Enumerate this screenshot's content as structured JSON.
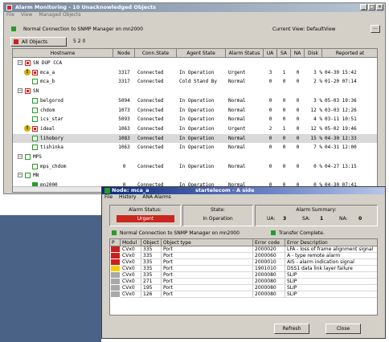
{
  "main_window": {
    "title": "Alarm Monitoring - 10 Unacknowledged Objects",
    "menu": [
      "File",
      "View",
      "Managed Objects"
    ],
    "connection_status": "Normal Connection to SNMP Manager  on  mn2000",
    "current_view": "Current View:  DefaultView",
    "more_button": "...",
    "objects_button": "All Objects",
    "objects_count": "5 2 0",
    "columns": [
      "Hostname",
      "Node",
      "Conn.State",
      "Agent State",
      "Alarm Status",
      "UA",
      "SA",
      "NA",
      "Disk",
      "Reported at"
    ],
    "rows": [
      {
        "indent": 0,
        "expander": "−",
        "icon": "red",
        "alert": false,
        "hostname": "SN DUP CCA",
        "node": "",
        "conn": "",
        "agent": "",
        "alarm": "",
        "ua": "",
        "sa": "",
        "na": "",
        "disk": "",
        "reported": ""
      },
      {
        "indent": 1,
        "expander": "",
        "icon": "red",
        "alert": true,
        "hostname": "mca_a",
        "node": "3317",
        "conn": "Connected",
        "agent": "In Operation",
        "alarm": "Urgent",
        "ua": "3",
        "sa": "1",
        "na": "0",
        "disk": "3 %",
        "reported": "04-30 15:42"
      },
      {
        "indent": 1,
        "expander": "",
        "icon": "green",
        "alert": false,
        "hostname": "mca_b",
        "node": "3317",
        "conn": "Connected",
        "agent": "Cold Stand By",
        "alarm": "Normal",
        "ua": "0",
        "sa": "0",
        "na": "0",
        "disk": "2 %",
        "reported": "01-20 07:14"
      },
      {
        "indent": 0,
        "expander": "−",
        "icon": "red",
        "alert": false,
        "hostname": "SN",
        "node": "",
        "conn": "",
        "agent": "",
        "alarm": "",
        "ua": "",
        "sa": "",
        "na": "",
        "disk": "",
        "reported": ""
      },
      {
        "indent": 1,
        "expander": "",
        "icon": "green",
        "alert": false,
        "hostname": "belgorod",
        "node": "5094",
        "conn": "Connected",
        "agent": "In Operation",
        "alarm": "Normal",
        "ua": "0",
        "sa": "0",
        "na": "0",
        "disk": "3 %",
        "reported": "05-03 19:36"
      },
      {
        "indent": 1,
        "expander": "",
        "icon": "green",
        "alert": false,
        "hostname": "chdom",
        "node": "1073",
        "conn": "Connected",
        "agent": "In Operation",
        "alarm": "Normal",
        "ua": "0",
        "sa": "0",
        "na": "0",
        "disk": "12 %",
        "reported": "03-03 12:26"
      },
      {
        "indent": 1,
        "expander": "",
        "icon": "green",
        "alert": false,
        "hostname": "ics_star",
        "node": "5093",
        "conn": "Connected",
        "agent": "In Operation",
        "alarm": "Normal",
        "ua": "0",
        "sa": "0",
        "na": "0",
        "disk": "4 %",
        "reported": "03-11 10:51"
      },
      {
        "indent": 1,
        "expander": "",
        "icon": "red",
        "alert": true,
        "hostname": "ideal",
        "node": "1063",
        "conn": "Connected",
        "agent": "In Operation",
        "alarm": "Urgent",
        "ua": "2",
        "sa": "1",
        "na": "0",
        "disk": "12 %",
        "reported": "05-02 19:46"
      },
      {
        "indent": 1,
        "expander": "",
        "icon": "green",
        "alert": false,
        "hostname": "lihobory",
        "node": "1083",
        "conn": "Connected",
        "agent": "In Operation",
        "alarm": "Normal",
        "ua": "0",
        "sa": "0",
        "na": "0",
        "disk": "15 %",
        "reported": "04-30 12:33",
        "selected": true
      },
      {
        "indent": 1,
        "expander": "",
        "icon": "green",
        "alert": false,
        "hostname": "tishinka",
        "node": "1063",
        "conn": "Connected",
        "agent": "In Operation",
        "alarm": "Normal",
        "ua": "0",
        "sa": "0",
        "na": "0",
        "disk": "7 %",
        "reported": "04-31 12:00"
      },
      {
        "indent": 0,
        "expander": "−",
        "icon": "greenbox",
        "alert": false,
        "hostname": "MPS",
        "node": "",
        "conn": "",
        "agent": "",
        "alarm": "",
        "ua": "",
        "sa": "",
        "na": "",
        "disk": "",
        "reported": ""
      },
      {
        "indent": 1,
        "expander": "",
        "icon": "green",
        "alert": false,
        "hostname": "mps_chdom",
        "node": "0",
        "conn": "Connected",
        "agent": "In Operation",
        "alarm": "Normal",
        "ua": "0",
        "sa": "0",
        "na": "0",
        "disk": "0 %",
        "reported": "04-27 13:15"
      },
      {
        "indent": 0,
        "expander": "−",
        "icon": "greenbox",
        "alert": false,
        "hostname": "MN",
        "node": "",
        "conn": "",
        "agent": "",
        "alarm": "",
        "ua": "",
        "sa": "",
        "na": "",
        "disk": "",
        "reported": ""
      },
      {
        "indent": 1,
        "expander": "",
        "icon": "greenfill",
        "alert": false,
        "hostname": "mn2000",
        "node": "0",
        "conn": "Connected",
        "agent": "In Operation",
        "alarm": "Normal",
        "ua": "0",
        "sa": "0",
        "na": "0",
        "disk": "0 %",
        "reported": "04-30 07:41"
      }
    ]
  },
  "node_window": {
    "title": "Node: mca_a",
    "title_right": "startelecom - A side",
    "menu": [
      "File",
      "History",
      "ANA Alarms"
    ],
    "alarm_status_label": "Alarm Status:",
    "alarm_status_value": "Urgent",
    "state_label": "State:",
    "state_value": "In Operation",
    "summary_label": "Alarm Summary:",
    "ua_label": "UA:",
    "ua_value": "3",
    "sa_label": "SA:",
    "sa_value": "1",
    "na_label": "NA:",
    "na_value": "0",
    "connection_status": "Normal Connection to SNMP Manager on mn2000",
    "transfer_status": "Transfer Complete.",
    "columns": [
      "P",
      "Modul",
      "Object",
      "Object type",
      "Error code",
      "Error Description"
    ],
    "alarms": [
      {
        "sev": "#cc1e1e",
        "modul": "CVx0",
        "object": "335",
        "type": "Port",
        "code": "2000020",
        "desc": "LFA - loss of frame alignment signal"
      },
      {
        "sev": "#cc1e1e",
        "modul": "CVx0",
        "object": "335",
        "type": "Port",
        "code": "2000060",
        "desc": "A - type remote alarm"
      },
      {
        "sev": "#cc1e1e",
        "modul": "CVx0",
        "object": "335",
        "type": "Port",
        "code": "2000010",
        "desc": "AIS - alarm indication signal"
      },
      {
        "sev": "#f0d000",
        "modul": "CVx0",
        "object": "335",
        "type": "Port",
        "code": "1901010",
        "desc": "DSS1 data link layer failure"
      },
      {
        "sev": "#a8a8a8",
        "modul": "CVx0",
        "object": "335",
        "type": "Port",
        "code": "2000080",
        "desc": "SLIP"
      },
      {
        "sev": "#a8a8a8",
        "modul": "CVx0",
        "object": "271",
        "type": "Port",
        "code": "2000080",
        "desc": "SLIP"
      },
      {
        "sev": "#a8a8a8",
        "modul": "CVx0",
        "object": "195",
        "type": "Port",
        "code": "2000080",
        "desc": "SLIP"
      },
      {
        "sev": "#a8a8a8",
        "modul": "CVx0",
        "object": "126",
        "type": "Port",
        "code": "2000080",
        "desc": "SLIP"
      }
    ],
    "refresh_label": "Refresh",
    "close_label": "Close"
  }
}
